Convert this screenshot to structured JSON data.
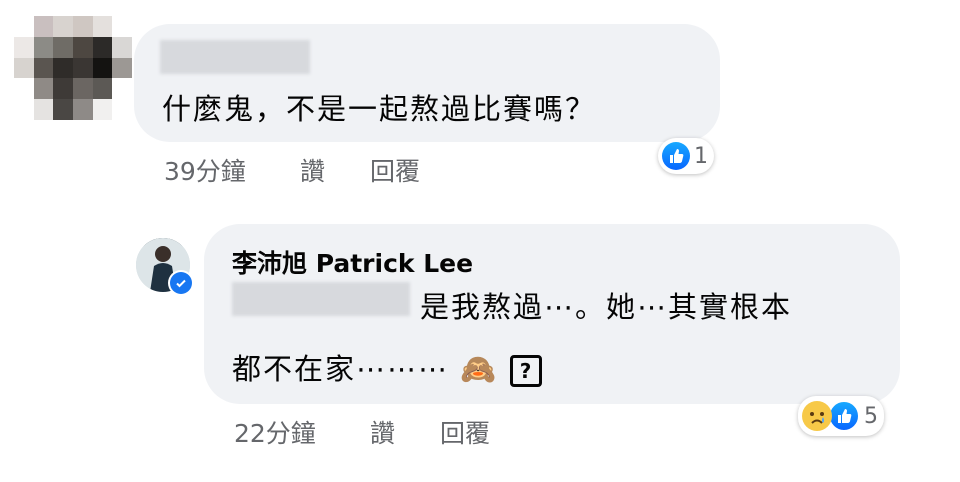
{
  "comment1": {
    "text": "什麼鬼，不是一起熬過比賽嗎？",
    "time": "39分鐘",
    "like_label": "讚",
    "reply_label": "回覆",
    "reaction_count": "1"
  },
  "reply1": {
    "author": "李沛旭 Patrick Lee",
    "text_line1": "是我熬過⋯。她⋯其實根本",
    "text_line2": "都不在家⋯⋯⋯",
    "emoji": "🙈",
    "unknown_glyph": "?",
    "time": "22分鐘",
    "like_label": "讚",
    "reply_label": "回覆",
    "reaction_count": "5"
  },
  "colors": {
    "bubble": "#f0f2f5",
    "meta_text": "#65676b",
    "like_blue": "#0866ff",
    "verified_blue": "#1877f2"
  },
  "icons": [
    "like-icon",
    "sad-icon",
    "verified-badge-icon",
    "see-no-evil-monkey-icon"
  ]
}
